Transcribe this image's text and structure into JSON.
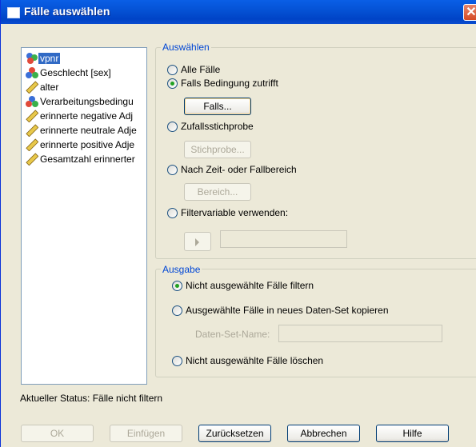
{
  "window": {
    "title": "Fälle auswählen",
    "close_glyph": "✕"
  },
  "variables": [
    {
      "label": "vpnr",
      "icon": "nominal-icon",
      "selected": true
    },
    {
      "label": "Geschlecht [sex]",
      "icon": "nominal-icon"
    },
    {
      "label": "alter",
      "icon": "scale-icon"
    },
    {
      "label": "Verarbeitungsbedingu",
      "icon": "nominal-icon"
    },
    {
      "label": "erinnerte negative Adj",
      "icon": "scale-icon"
    },
    {
      "label": "erinnerte neutrale Adje",
      "icon": "scale-icon"
    },
    {
      "label": "erinnerte positive Adje",
      "icon": "scale-icon"
    },
    {
      "label": "Gesamtzahl erinnerter",
      "icon": "scale-icon"
    }
  ],
  "select_group": {
    "title": "Auswählen",
    "all_cases": "Alle Fälle",
    "if_condition": "Falls Bedingung zutrifft",
    "if_button": "Falls...",
    "random_sample": "Zufallsstichprobe",
    "sample_button": "Stichprobe...",
    "range": "Nach Zeit- oder Fallbereich",
    "range_button": "Bereich...",
    "filter_var": "Filtervariable verwenden:"
  },
  "output_group": {
    "title": "Ausgabe",
    "filter_out": "Nicht ausgewählte Fälle filtern",
    "copy_dataset": "Ausgewählte Fälle in neues Daten-Set kopieren",
    "dataset_name_label": "Daten-Set-Name:",
    "delete": "Nicht ausgewählte Fälle löschen"
  },
  "status": "Aktueller Status: Fälle nicht filtern",
  "buttons": {
    "ok": "OK",
    "paste": "Einfügen",
    "reset": "Zurücksetzen",
    "cancel": "Abbrechen",
    "help": "Hilfe"
  }
}
